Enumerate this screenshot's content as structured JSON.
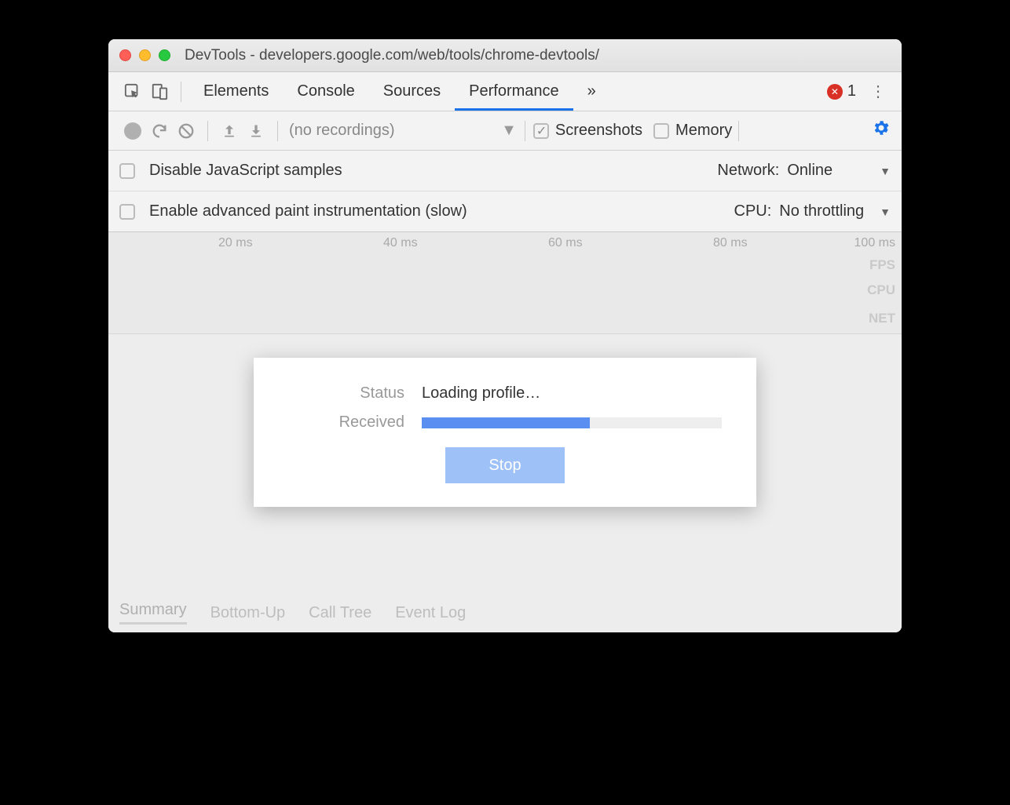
{
  "window": {
    "title": "DevTools - developers.google.com/web/tools/chrome-devtools/"
  },
  "tabs": {
    "items": [
      "Elements",
      "Console",
      "Sources",
      "Performance"
    ],
    "active": "Performance",
    "overflow_glyph": "»",
    "error_count": "1",
    "kebab_glyph": "⋮"
  },
  "perfbar": {
    "recordings_label": "(no recordings)",
    "screenshots_label": "Screenshots",
    "memory_label": "Memory",
    "screenshots_checked": true,
    "memory_checked": false
  },
  "options": {
    "disable_js": "Disable JavaScript samples",
    "enable_paint": "Enable advanced paint instrumentation (slow)",
    "network_label": "Network:",
    "network_value": "Online",
    "cpu_label": "CPU:",
    "cpu_value": "No throttling"
  },
  "ruler": {
    "ticks": [
      "20 ms",
      "40 ms",
      "60 ms",
      "80 ms",
      "100 ms"
    ],
    "lanes": [
      "FPS",
      "CPU",
      "NET"
    ]
  },
  "modal": {
    "status_label": "Status",
    "status_value": "Loading profile…",
    "received_label": "Received",
    "progress_pct": 56,
    "stop_label": "Stop"
  },
  "bottom_tabs": {
    "items": [
      "Summary",
      "Bottom-Up",
      "Call Tree",
      "Event Log"
    ],
    "active": "Summary"
  }
}
